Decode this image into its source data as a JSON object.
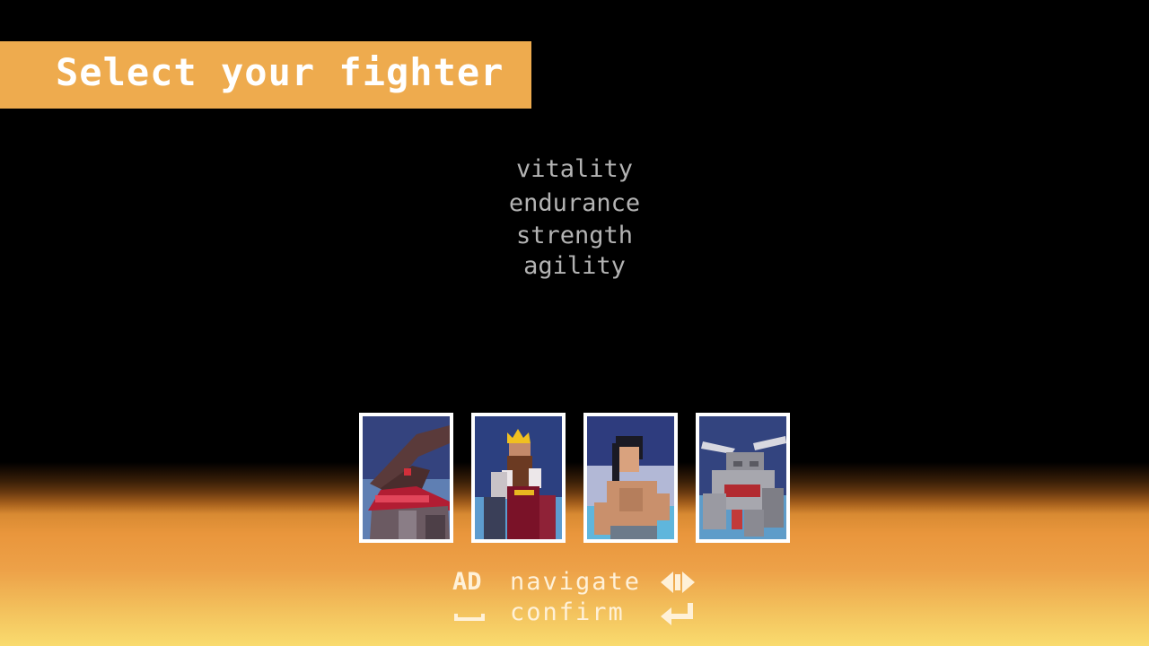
{
  "title": "Select your fighter",
  "stats": [
    "vitality",
    "endurance",
    "strength",
    "agility"
  ],
  "fighters": [
    {
      "name": "hooded-warrior",
      "selected": false
    },
    {
      "name": "crowned-king",
      "selected": false
    },
    {
      "name": "shirtless-swordsman",
      "selected": false
    },
    {
      "name": "stone-beast",
      "selected": false
    }
  ],
  "controls": {
    "navigate": {
      "key": "AD",
      "label": "navigate",
      "icon": "left-right-arrows-icon"
    },
    "confirm": {
      "key": "space-bar-icon",
      "label": "confirm",
      "icon": "enter-key-icon"
    }
  },
  "colors": {
    "banner": "#eeab4e",
    "stat_text": "#b3b3b3",
    "control_text": "#fff1d8",
    "card_border": "#ffffff"
  }
}
